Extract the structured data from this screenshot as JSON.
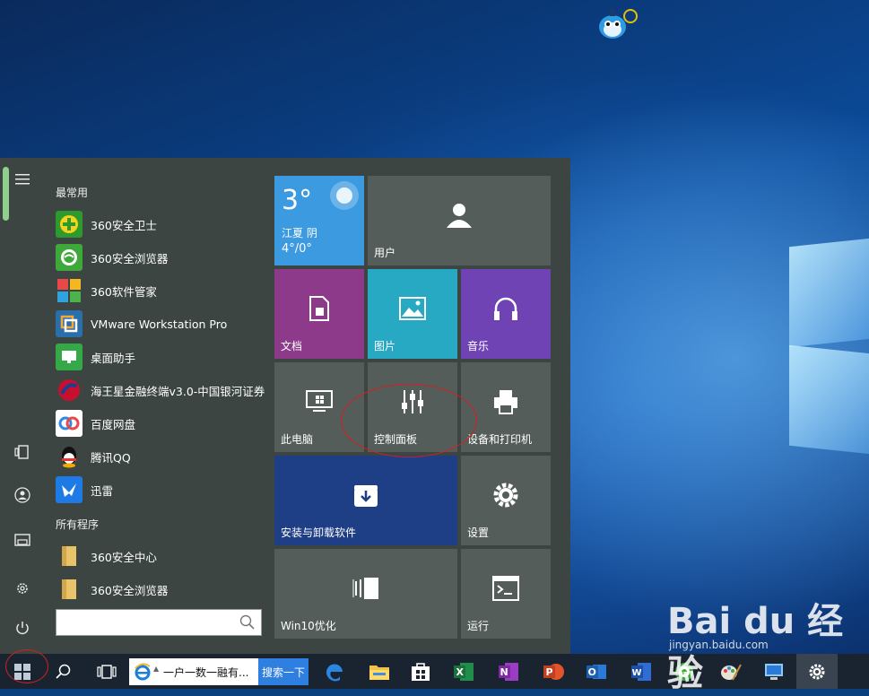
{
  "start_menu": {
    "most_used_title": "最常用",
    "most_used": [
      {
        "label": "360安全卫士",
        "icon": "360-safe-guard-icon",
        "color": "#3aa534"
      },
      {
        "label": "360安全浏览器",
        "icon": "360-browser-icon",
        "color": "#2e9d3d"
      },
      {
        "label": "360软件管家",
        "icon": "360-software-manager-icon",
        "color": "#e23c3c"
      },
      {
        "label": "VMware Workstation Pro",
        "icon": "vmware-icon",
        "color": "#1f6fb0"
      },
      {
        "label": "桌面助手",
        "icon": "desktop-assistant-icon",
        "color": "#33a843"
      },
      {
        "label": "海王星金融终端v3.0-中国银河证券",
        "icon": "neptune-finance-icon",
        "color": "#c8102e"
      },
      {
        "label": "百度网盘",
        "icon": "baidu-netdisk-icon",
        "color": "#2f8ae6"
      },
      {
        "label": "腾讯QQ",
        "icon": "qq-icon",
        "color": "#000000"
      },
      {
        "label": "迅雷",
        "icon": "xunlei-icon",
        "color": "#1e7be6"
      }
    ],
    "all_programs_title": "所有程序",
    "all_programs": [
      {
        "label": "360安全中心",
        "icon": "folder-icon",
        "color": "#e8c36a"
      },
      {
        "label": "360安全浏览器",
        "icon": "folder-icon",
        "color": "#e8c36a"
      }
    ],
    "search_placeholder": ""
  },
  "tiles": {
    "weather": {
      "temp": "3°",
      "city": "江夏 阴",
      "range": "4°/0°",
      "color": "#3b9ae0"
    },
    "user": {
      "label": "用户"
    },
    "documents": {
      "label": "文档",
      "color": "#8d3a8b"
    },
    "pictures": {
      "label": "图片",
      "color": "#27a9c4"
    },
    "music": {
      "label": "音乐",
      "color": "#7043b5"
    },
    "this_pc": {
      "label": "此电脑"
    },
    "control_panel": {
      "label": "控制面板"
    },
    "devices_printers": {
      "label": "设备和打印机"
    },
    "install_uninstall": {
      "label": "安装与卸载软件",
      "color": "#1e3f86"
    },
    "settings": {
      "label": "设置"
    },
    "win10_optimize": {
      "label": "Win10优化"
    },
    "run": {
      "label": "运行"
    }
  },
  "taskbar": {
    "ie_text": "一户一数一融有...",
    "search_button": "搜索一下",
    "pinned": [
      "edge-icon",
      "file-explorer-icon",
      "store-icon",
      "excel-icon",
      "onenote-icon",
      "powerpoint-icon",
      "outlook-icon",
      "word-icon",
      "360-browser-icon",
      "paint-icon",
      "network-icon",
      "settings-icon"
    ]
  },
  "watermark": {
    "brand": "Bai du 经验",
    "sub": "jingyan.baidu.com"
  }
}
